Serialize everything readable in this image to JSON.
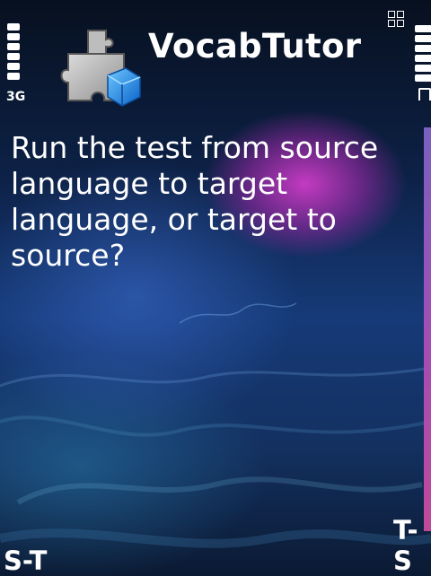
{
  "status_bar": {
    "network_type": "3G",
    "signal_icon": "signal-strength-icon",
    "battery_icon": "battery-icon",
    "charging_icon": "plug-icon",
    "menu_icon": "app-grid-icon"
  },
  "app": {
    "title": "VocabTutor",
    "icon": "puzzle-piece-icon"
  },
  "dialog": {
    "question": "Run the test from source language to target language, or target to source?"
  },
  "softkeys": {
    "left_label": "S-T",
    "right_label": "T-S"
  },
  "colors": {
    "accent": "#c63fc0",
    "background": "#163a78",
    "text": "#ffffff"
  }
}
